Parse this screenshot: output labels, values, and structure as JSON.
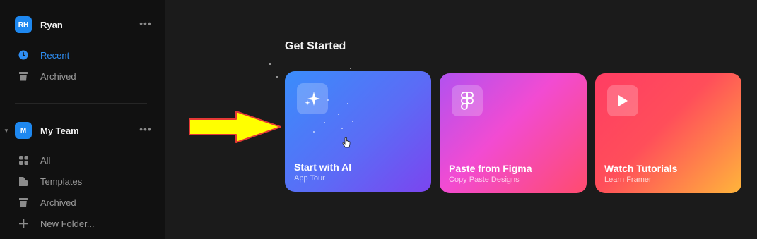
{
  "sidebar": {
    "profile": {
      "initials": "RH",
      "name": "Ryan",
      "more": "•••"
    },
    "personal_items": [
      {
        "label": "Recent",
        "icon": "clock-icon",
        "active": true
      },
      {
        "label": "Archived",
        "icon": "trash-icon",
        "active": false
      }
    ],
    "team": {
      "initials": "M",
      "name": "My Team",
      "more": "•••",
      "caret": "▼"
    },
    "team_items": [
      {
        "label": "All",
        "icon": "grid-icon"
      },
      {
        "label": "Templates",
        "icon": "templates-icon"
      },
      {
        "label": "Archived",
        "icon": "trash-icon"
      },
      {
        "label": "New Folder...",
        "icon": "plus-icon"
      }
    ]
  },
  "main": {
    "section_title": "Get Started",
    "cards": [
      {
        "title": "Start with AI",
        "subtitle": "App Tour",
        "icon": "sparkle-icon"
      },
      {
        "title": "Paste from Figma",
        "subtitle": "Copy Paste Designs",
        "icon": "figma-icon"
      },
      {
        "title": "Watch Tutorials",
        "subtitle": "Learn Framer",
        "icon": "play-icon"
      }
    ]
  },
  "colors": {
    "accent": "#2f8ef3",
    "avatar": "#1e88f0",
    "arrow_fill": "#ffff00",
    "arrow_stroke": "#e53935"
  }
}
